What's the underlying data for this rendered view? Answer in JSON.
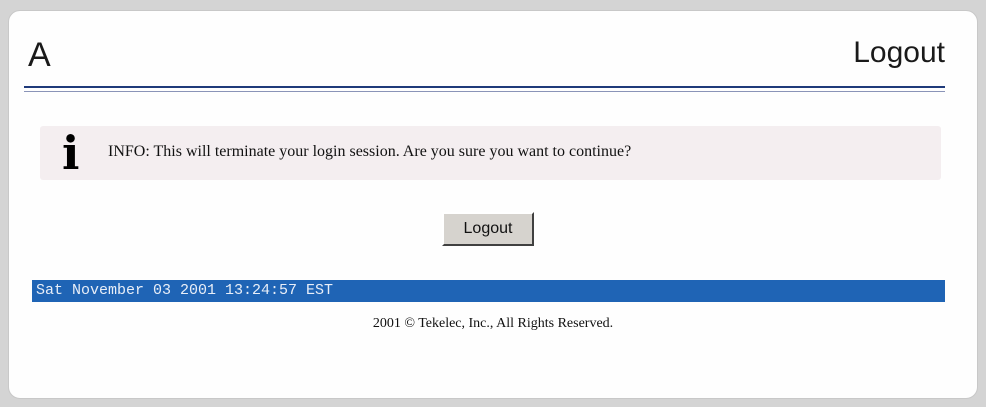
{
  "header": {
    "letter": "A",
    "title": "Logout"
  },
  "info": {
    "icon": "info-icon",
    "message": "INFO: This will terminate your login session. Are you sure you want to continue?"
  },
  "actions": {
    "logout_label": "Logout"
  },
  "status_bar": {
    "datetime": "Sat November 03 2001 13:24:57 EST",
    "color": "#1f64b5"
  },
  "footer": {
    "copyright": "2001 © Tekelec, Inc., All Rights Reserved."
  },
  "colors": {
    "header_rule": "#1f3a7a",
    "info_background": "#f4eef0",
    "button_face": "#d6d3ce"
  }
}
